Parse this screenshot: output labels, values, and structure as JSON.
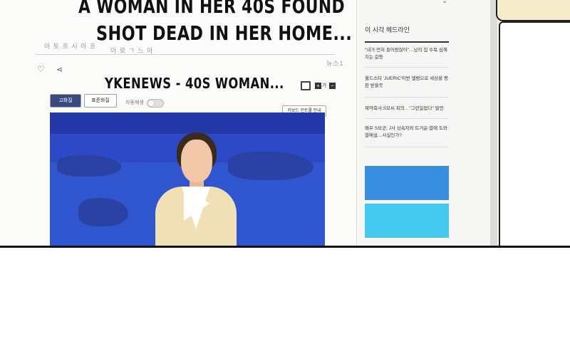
{
  "captions": {
    "line1": "A WOMAN IN HER 40S FOUND",
    "line2": "SHOT DEAD IN HER HOME...",
    "line3": "YKENEWS - 40S WOMAN..."
  },
  "article": {
    "tab_high": "고화질",
    "tab_standard": "표준화질",
    "autoplay_label": "자동재생",
    "toggle_state": "OFF",
    "keyboard_btn": "키보드 컨트롤 안내",
    "fontsize_plus": "+",
    "fontsize_label": "가",
    "fontsize_minus": "−",
    "scribble_a": "아 토 흐 시 아 흐",
    "scribble_b": "아 로 ㄱ 느 아",
    "scribble_c": "뉴스1"
  },
  "sidebar": {
    "title": "이 시각 헤드라인",
    "items": [
      "\"내가 먼저 들어왔잖아\"…남의 집 수목 심해지는 갈등",
      "월드스타 'JUERIC'이번 앨범으로 세상을 평판 받을듯",
      "제약회사 S모씨 피의…\"그런일없다\" 발언",
      "배우 S모군, J사 상속자와 트거운 열애 도와 열애설…사실인가?"
    ],
    "ad_colors": [
      "#3a8fe0",
      "#45c8ef"
    ]
  },
  "colors": {
    "video_blue": "#2d49c6",
    "tab_active": "#3b4a7d"
  }
}
